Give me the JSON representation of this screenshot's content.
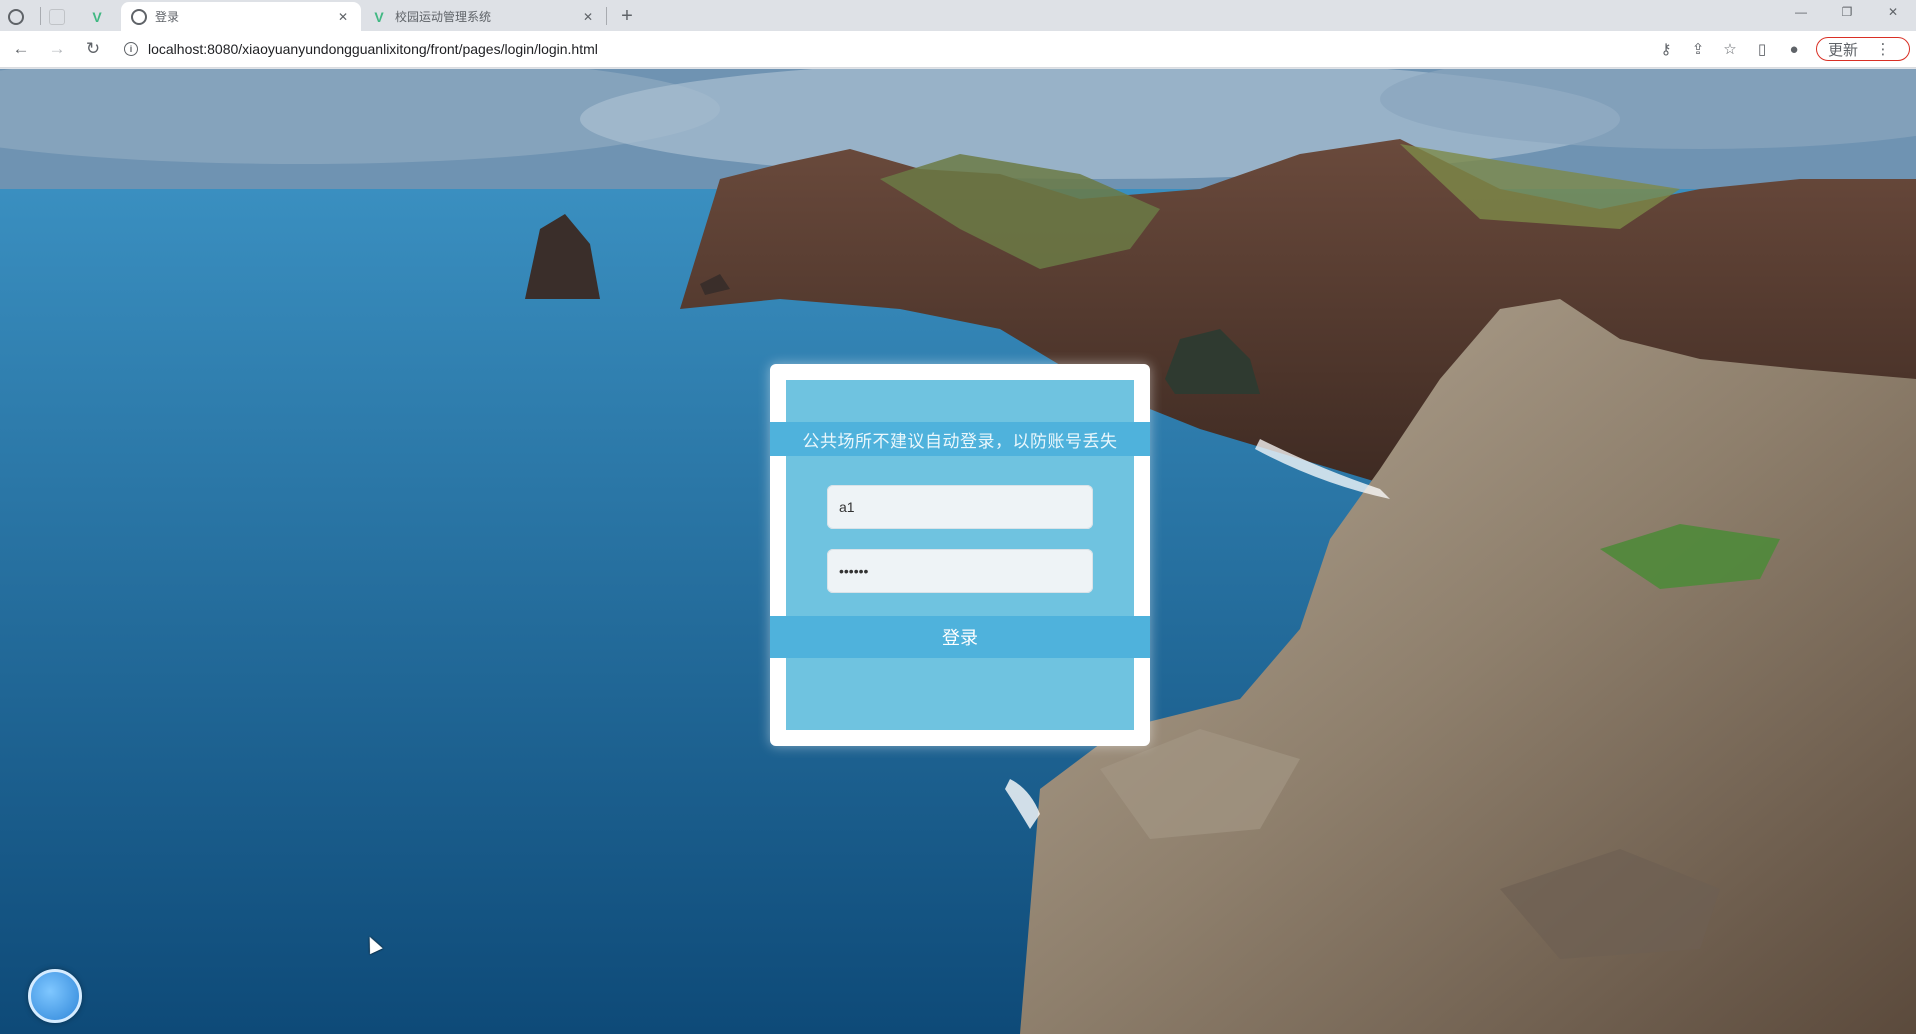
{
  "browser": {
    "tabs": [
      {
        "title": "",
        "type": "pinned-globe"
      },
      {
        "title": "",
        "type": "pinned-blank"
      },
      {
        "title": "",
        "type": "pinned-vue"
      },
      {
        "title": "登录",
        "type": "active"
      },
      {
        "title": "校园运动管理系统",
        "type": "normal"
      }
    ],
    "new_tab": "+",
    "window_controls": [
      "—",
      "❐",
      "✕"
    ],
    "url": "localhost:8080/xiaoyuanyundongguanlixitong/front/pages/login/login.html",
    "update_label": "更新",
    "update_menu": "⋮"
  },
  "login": {
    "title": "公共场所不建议自动登录，以防账号丢失",
    "username_value": "a1",
    "password_value": "••••••",
    "login_button": "登录"
  },
  "colors": {
    "card_bg": "#ffffff",
    "card_inner": "#6fc3e0",
    "band": "#4fb2dc"
  }
}
